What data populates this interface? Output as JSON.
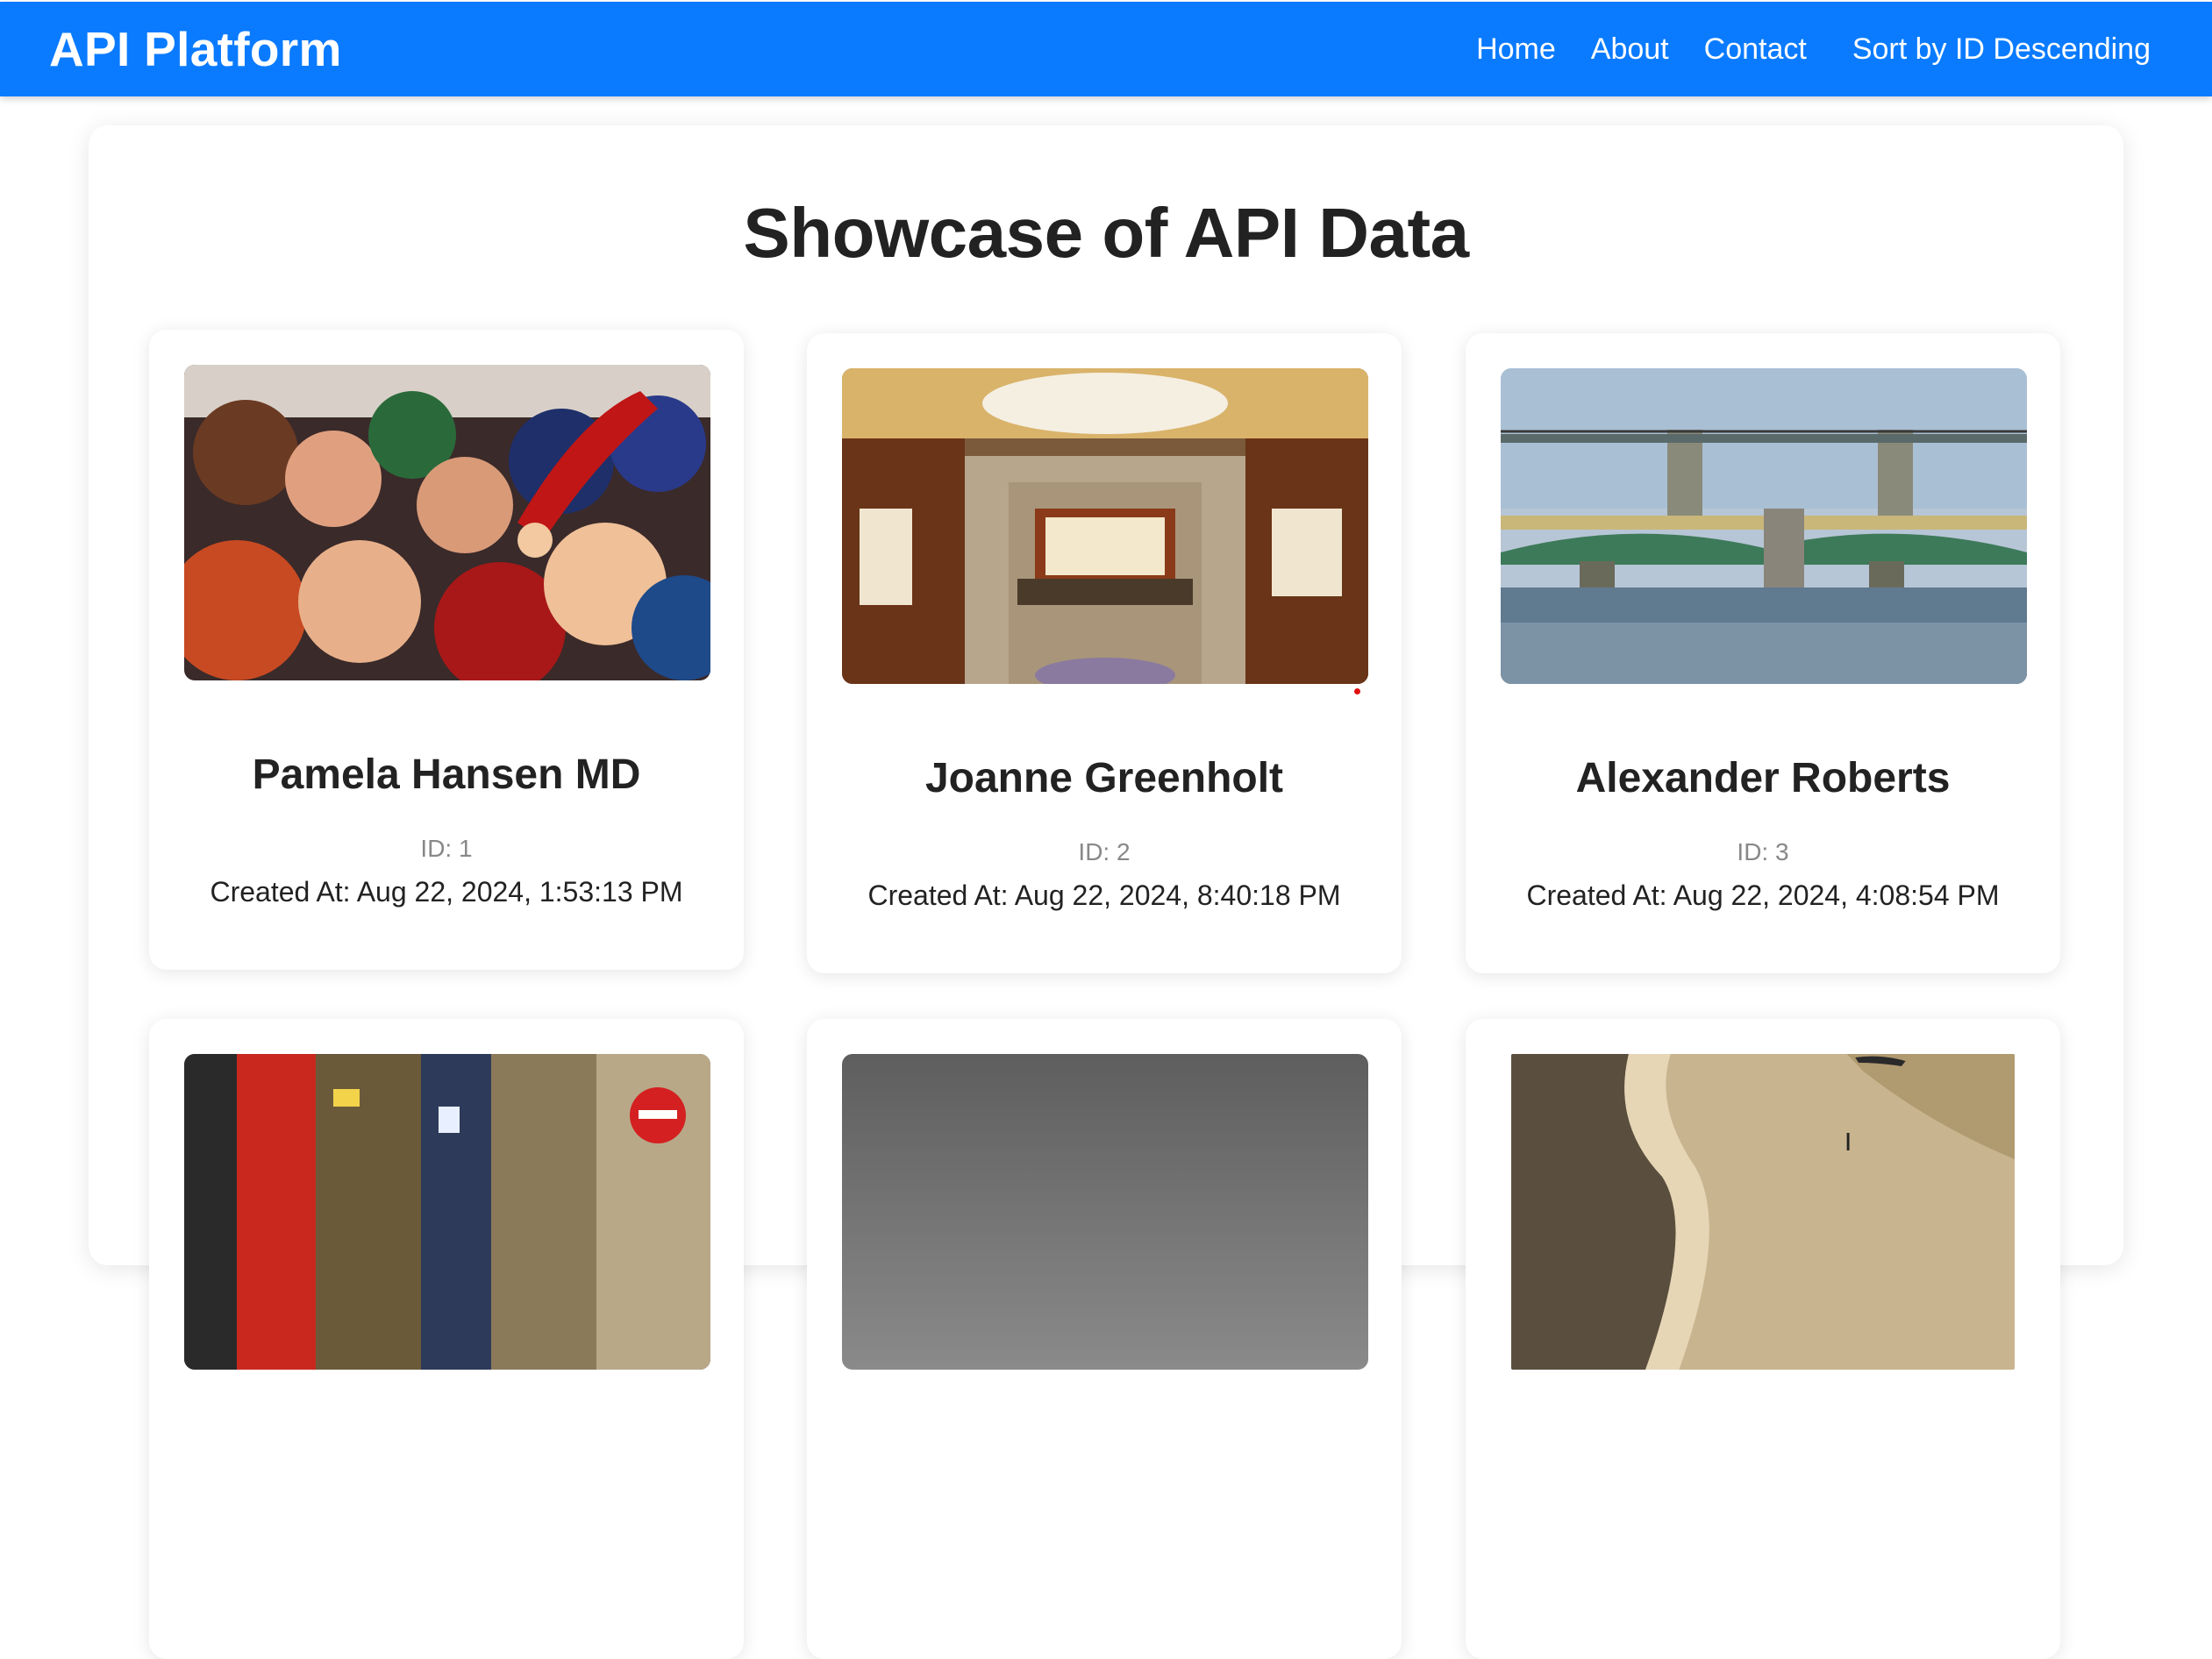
{
  "navbar": {
    "brand": "API Platform",
    "links": [
      "Home",
      "About",
      "Contact"
    ],
    "sort_label": "Sort by ID Descending"
  },
  "page": {
    "title": "Showcase of API Data"
  },
  "cards": [
    {
      "name": "Pamela Hansen MD",
      "id_text": "ID: 1",
      "created_text": "Created At: Aug 22, 2024, 1:53:13 PM",
      "image": "crowd-photo"
    },
    {
      "name": "Joanne Greenholt",
      "id_text": "ID: 2",
      "created_text": "Created At: Aug 22, 2024, 8:40:18 PM",
      "image": "hotel-lobby-photo"
    },
    {
      "name": "Alexander Roberts",
      "id_text": "ID: 3",
      "created_text": "Created At: Aug 22, 2024, 4:08:54 PM",
      "image": "london-bridge-photo"
    },
    {
      "name": "",
      "id_text": "",
      "created_text": "",
      "image": "tokyo-street-photo"
    },
    {
      "name": "",
      "id_text": "",
      "created_text": "",
      "image": "grey-sky-photo"
    },
    {
      "name": "",
      "id_text": "",
      "created_text": "",
      "image": "beach-photo"
    }
  ],
  "colors": {
    "navbar": "#0a7bff",
    "background": "#ffffff",
    "title_text": "#222222",
    "id_text": "#888888"
  }
}
